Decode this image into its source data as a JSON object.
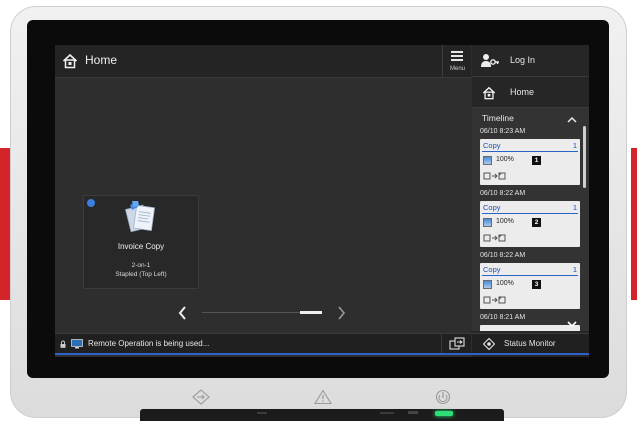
{
  "header": {
    "title": "Home",
    "menu_label": "Menu"
  },
  "right_panel": {
    "login_label": "Log In",
    "home_label": "Home",
    "timeline": {
      "title": "Timeline",
      "jobs": [
        {
          "time": "06/10 8:23 AM",
          "name": "Copy",
          "count": "1",
          "zoom": "100%",
          "badge": "1"
        },
        {
          "time": "06/10 8:22 AM",
          "name": "Copy",
          "count": "1",
          "zoom": "100%",
          "badge": "2"
        },
        {
          "time": "06/10 8:22 AM",
          "name": "Copy",
          "count": "1",
          "zoom": "100%",
          "badge": "3"
        },
        {
          "time": "06/10 8:21 AM"
        }
      ]
    }
  },
  "main": {
    "tile": {
      "name": "Invoice Copy",
      "setting_1": "2-on-1",
      "setting_2": "Stapled (Top Left)"
    }
  },
  "status_bar": {
    "message": "Remote Operation is being used..."
  },
  "status_monitor_label": "Status Monitor",
  "colors": {
    "accent": "#2e62c8",
    "brand_red": "#d3242a",
    "power_led": "#2fe07a",
    "new_dot": "#3b7fe0"
  }
}
